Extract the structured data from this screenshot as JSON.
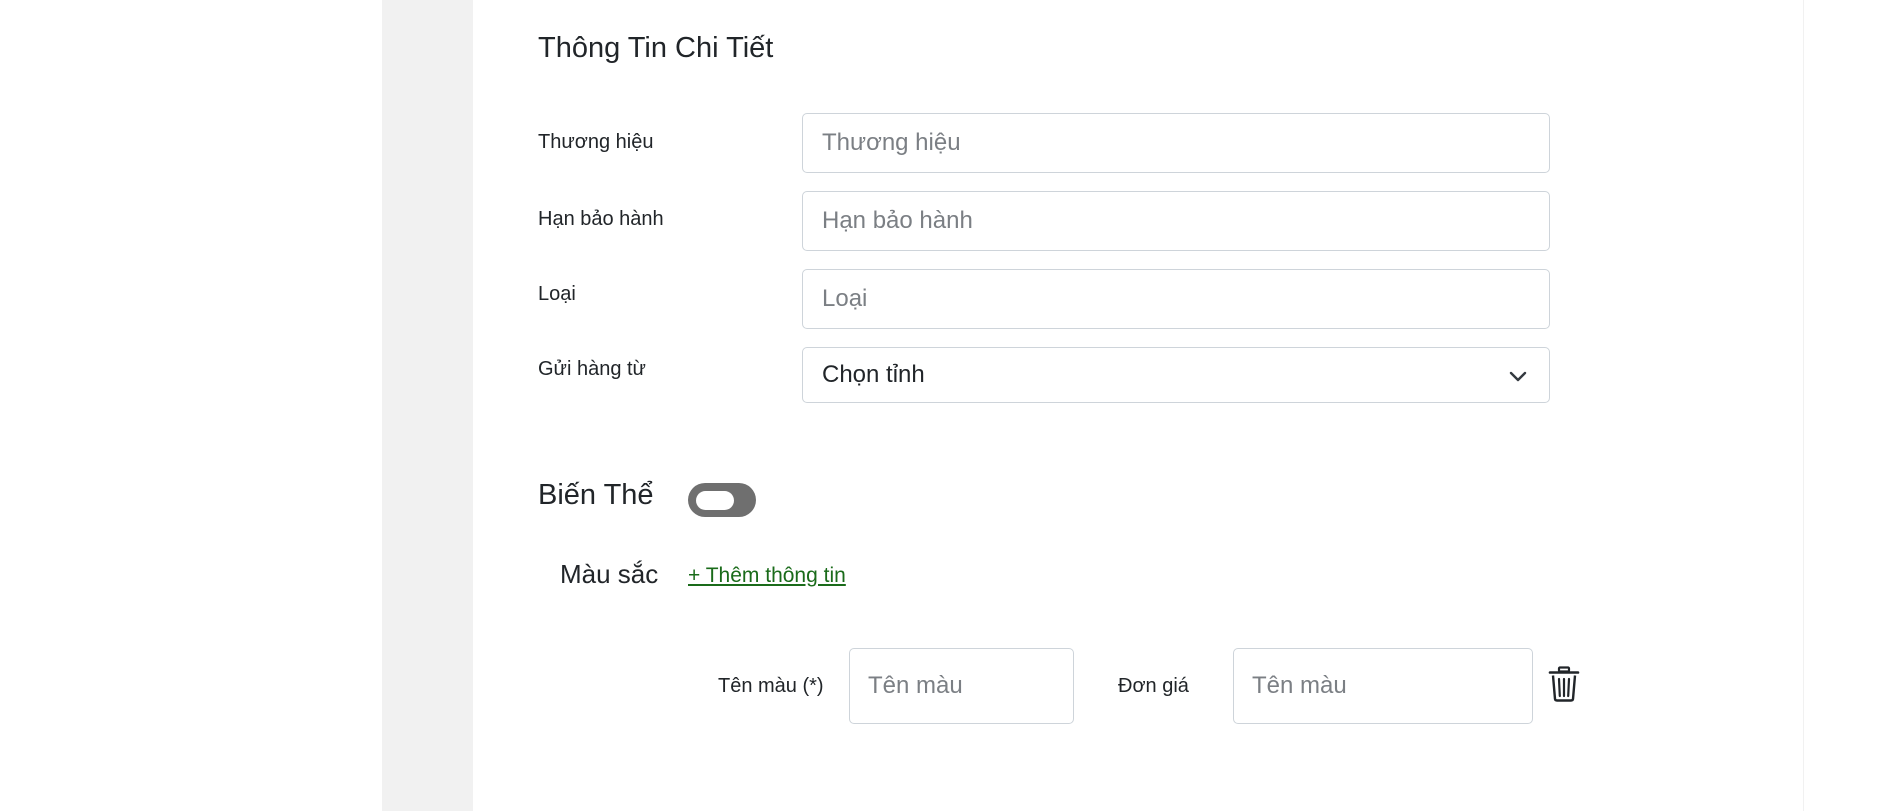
{
  "details": {
    "title": "Thông Tin Chi Tiết",
    "fields": [
      {
        "label": "Thương hiệu",
        "placeholder": "Thương hiệu",
        "value": ""
      },
      {
        "label": "Hạn bảo hành",
        "placeholder": "Hạn bảo hành",
        "value": ""
      },
      {
        "label": "Loại",
        "placeholder": "Loại",
        "value": ""
      }
    ],
    "ship_from": {
      "label": "Gửi hàng từ",
      "selected": "Chọn tỉnh"
    }
  },
  "variants": {
    "title": "Biến Thể",
    "toggle_on": false,
    "color_group": {
      "title": "Màu sắc",
      "add_link": "+ Thêm thông tin",
      "row": {
        "name_label": "Tên màu (*)",
        "name_placeholder": "Tên màu",
        "price_label": "Đơn giá",
        "price_placeholder": "Tên màu"
      }
    }
  },
  "icons": {
    "select_arrow": "chevron-down-icon",
    "delete": "trash-icon"
  },
  "colors": {
    "link": "#1a6b1a",
    "toggle_off": "#6f6f6f",
    "page_background": "#f1f1f1"
  }
}
